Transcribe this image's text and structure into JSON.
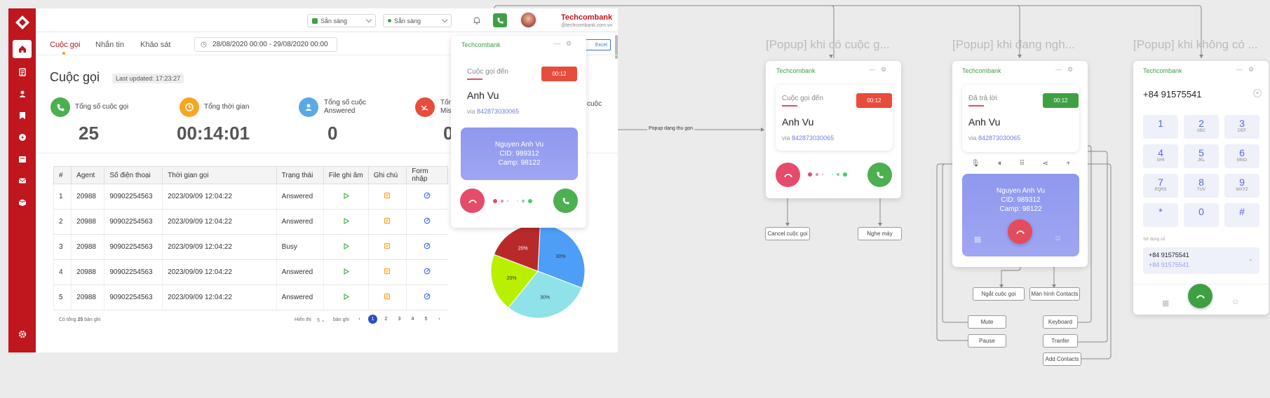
{
  "sidebar": {
    "items": [
      "home-icon",
      "document-icon",
      "user-icon",
      "bookmark-icon",
      "video-icon",
      "calendar-icon",
      "mail-icon",
      "box-icon"
    ],
    "settings": "settings-icon"
  },
  "topbar": {
    "status_1": "Sẵn sàng",
    "status_2": "Sẵn sàng",
    "brand": "Techcombank",
    "email": "@techcombank.com.vn",
    "export_label": "Excel"
  },
  "tabs": [
    "Cuộc gọi",
    "Nhắn tin",
    "Khảo sát"
  ],
  "date_range": "28/08/2020 00:00 - 29/08/2020 00:00",
  "page": {
    "title": "Cuộc gọi",
    "updated": "Last updated: 17:23:27"
  },
  "stats": [
    {
      "label": "Tổng số cuộc gọi",
      "value": "25",
      "color": "#4caf50"
    },
    {
      "label": "Tổng thời gian",
      "value": "00:14:01",
      "color": "#f5a623"
    },
    {
      "label": "Tổng số cuộc Answered",
      "value": "0",
      "color": "#5aa9e6"
    },
    {
      "label": "Tổng Miss",
      "value": "0",
      "color": "#e74c3c"
    }
  ],
  "stat_partial": "cuộc",
  "table": {
    "headers": [
      "#",
      "Agent",
      "Số điện thoại",
      "Thời gian gọi",
      "Trạng thái",
      "File ghi âm",
      "Ghi chú",
      "Form nhập"
    ],
    "rows": [
      [
        "1",
        "20988",
        "90902254563",
        "2023/09/09 12:04:22",
        "Answered"
      ],
      [
        "2",
        "20988",
        "90902254563",
        "2023/09/09 12:04:22",
        "Answered"
      ],
      [
        "3",
        "20988",
        "90902254563",
        "2023/09/09 12:04:22",
        "Busy"
      ],
      [
        "4",
        "20988",
        "90902254563",
        "2023/09/09 12:04:22",
        "Answered"
      ],
      [
        "5",
        "20988",
        "90902254563",
        "2023/09/09 12:04:22",
        "Answered"
      ]
    ]
  },
  "pager": {
    "total_prefix": "Có tổng",
    "total": "25",
    "total_suffix": "bản ghi",
    "show_label": "Hiển thị",
    "page_size": "5",
    "page_size_suffix": "bản ghi",
    "pages": [
      "1",
      "2",
      "3",
      "4",
      "5"
    ],
    "current": "1"
  },
  "pie": {
    "slices": [
      {
        "label": "30%",
        "value": 30,
        "color": "#4d9ef7"
      },
      {
        "label": "30%",
        "value": 30,
        "color": "#8fe3e8"
      },
      {
        "label": "20%",
        "value": 20,
        "color": "#b8f000"
      },
      {
        "label": "20%",
        "value": 20,
        "color": "#b82a2a"
      }
    ]
  },
  "popup_main": {
    "brand": "Techcombank",
    "status": "Cuộc gọi đến",
    "timer": "00:12",
    "caller": "Anh Vu",
    "via": "via",
    "number": "842873030065",
    "cid_name": "Nguyen Anh Vu",
    "cid": "CID: 989312",
    "camp": "Camp: 98122"
  },
  "arrow_label": "Popup dạng thu gọn",
  "sections": {
    "incoming_title": "[Popup] khi có cuộc g...",
    "answering_title": "[Popup] khi đang ngh...",
    "idle_title": "[Popup] khi không có ..."
  },
  "popup_incoming": {
    "brand": "Techcombank",
    "status": "Cuộc gọi đến",
    "timer": "00:12",
    "caller": "Anh Vu",
    "via": "via",
    "number": "842873030065",
    "cancel_label": "Cancel cuộc gọi",
    "answer_label": "Nghe máy"
  },
  "popup_answering": {
    "brand": "Techcombank",
    "status": "Đã trả lời",
    "timer": "00:12",
    "caller": "Anh Vu",
    "via": "via",
    "number": "842873030065",
    "cid_name": "Nguyen Anh Vu",
    "cid": "CID: 989312",
    "camp": "Camp: 98122",
    "labels": {
      "hangup": "Ngắt cuộc gọi",
      "contacts": "Màn hình Contacts",
      "mute": "Mute",
      "pause": "Pause",
      "keyboard": "Keyboard",
      "transfer": "Tranfer",
      "add": "Add Contacts"
    }
  },
  "popup_idle": {
    "brand": "Techcombank",
    "number": "+84 91575541",
    "keys": [
      {
        "d": "1",
        "s": ""
      },
      {
        "d": "2",
        "s": "ABC"
      },
      {
        "d": "3",
        "s": "DEF"
      },
      {
        "d": "4",
        "s": "GHI"
      },
      {
        "d": "5",
        "s": "JKL"
      },
      {
        "d": "6",
        "s": "MNO"
      },
      {
        "d": "7",
        "s": "PQRS"
      },
      {
        "d": "8",
        "s": "TUV"
      },
      {
        "d": "9",
        "s": "WXYZ"
      },
      {
        "d": "*",
        "s": ""
      },
      {
        "d": "0",
        "s": ""
      },
      {
        "d": "#",
        "s": ""
      }
    ],
    "used_label": "Sử dụng số",
    "used_primary": "+84 91575541",
    "used_secondary": "+84 91575541"
  },
  "colors": {
    "brand_red": "#c0161e",
    "green": "#3fa043",
    "timer_red": "#e74c3c",
    "accent_blue": "#6f7ee8"
  }
}
